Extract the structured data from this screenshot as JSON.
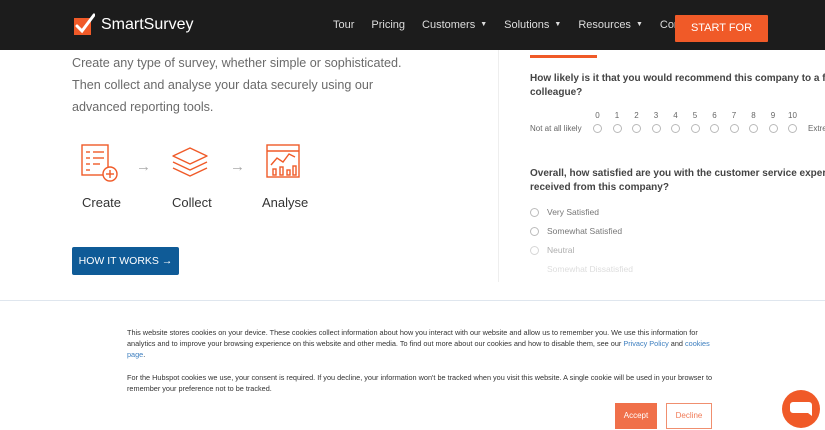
{
  "nav": {
    "brand": "SmartSurvey",
    "links": [
      {
        "label": "Tour",
        "caret": false
      },
      {
        "label": "Pricing",
        "caret": false
      },
      {
        "label": "Customers",
        "caret": true
      },
      {
        "label": "Solutions",
        "caret": true
      },
      {
        "label": "Resources",
        "caret": true
      },
      {
        "label": "Contact",
        "caret": false
      }
    ],
    "cta": "Start for free"
  },
  "intro": {
    "text": "Create any type of survey, whether simple or sophisticated. Then collect and analyse your data securely using our advanced reporting tools."
  },
  "steps": {
    "items": [
      {
        "label": "Create",
        "icon": "create-form-icon"
      },
      {
        "label": "Collect",
        "icon": "layers-icon"
      },
      {
        "label": "Analyse",
        "icon": "chart-icon"
      }
    ],
    "arrow": "→"
  },
  "how_button": "HOW IT WORKS  →",
  "survey": {
    "q1": "How likely is it that you would recommend this company to a friend or colleague?",
    "q1_line1": "How likely is it that you would recommend this company to a friend o",
    "q1_line2": "colleague?",
    "scale": [
      "0",
      "1",
      "2",
      "3",
      "4",
      "5",
      "6",
      "7",
      "8",
      "9",
      "10"
    ],
    "scale_low": "Not at all likely",
    "scale_high": "Extre",
    "q2_line1": "Overall, how satisfied are you with the customer service experience t",
    "q2_line2": "received from this company?",
    "options": [
      "Very Satisfied",
      "Somewhat Satisfied",
      "Neutral",
      "Somewhat Dissatisfied"
    ]
  },
  "cookie": {
    "p1_a": "This website stores cookies on your device. These cookies collect information about how you interact with our website and allow us to remember you. We use this information for analytics and to improve your browsing experience on this website and other media. To find out more about our cookies and how to disable them, see our ",
    "p1_link1": "Privacy Policy",
    "p1_and": " and ",
    "p1_link2": "cookies page",
    "p1_end": ".",
    "p2": "For the Hubspot cookies we use, your consent is required. If you decline, your information won't be tracked when you visit this website. A single cookie will be used in your browser to remember your preference not to be tracked.",
    "accept": "Accept",
    "decline": "Decline"
  },
  "colors": {
    "brand_orange": "#f05a28",
    "nav_bg": "#1c1c1c",
    "button_blue": "#0f5b97"
  }
}
